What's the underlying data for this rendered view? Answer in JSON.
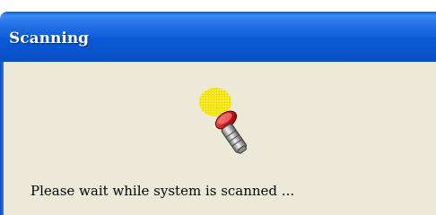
{
  "window": {
    "title": "Scanning",
    "titlebar_color": "#0a5ad8",
    "background_color": "#ece9d8"
  },
  "body": {
    "icon": "flashlight-scan-icon",
    "message": "Please wait while system is scanned ..."
  }
}
